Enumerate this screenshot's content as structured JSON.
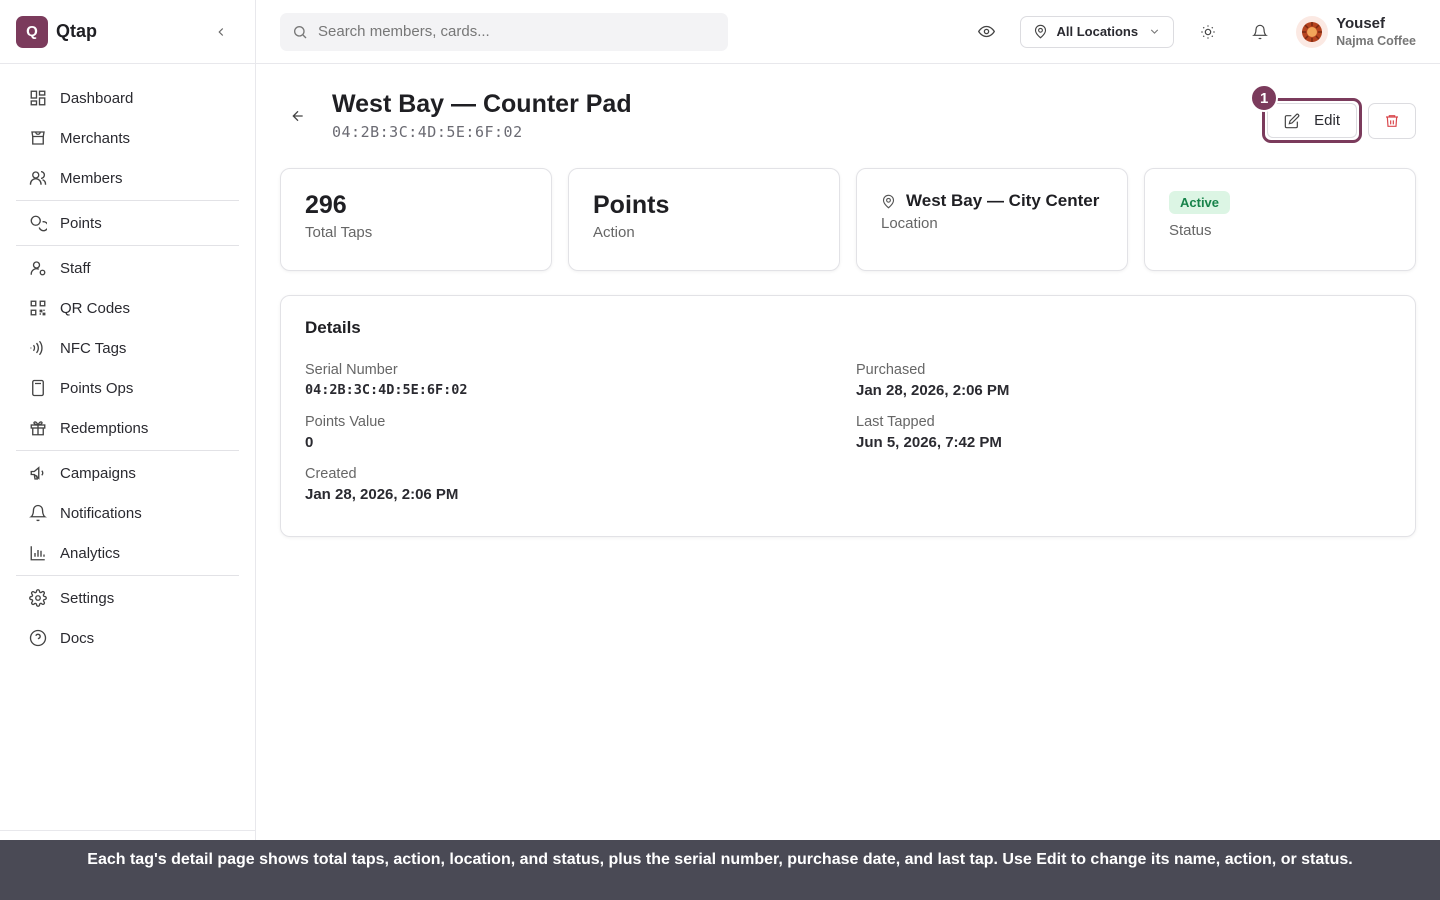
{
  "brand": {
    "logo_letter": "Q",
    "name": "Qtap"
  },
  "sidebar": {
    "items": [
      {
        "label": "Dashboard",
        "icon": "dashboard-icon"
      },
      {
        "label": "Merchants",
        "icon": "store-icon"
      },
      {
        "label": "Members",
        "icon": "users-icon"
      },
      {
        "label": "Points",
        "icon": "coins-icon"
      },
      {
        "label": "Staff",
        "icon": "user-cog-icon"
      },
      {
        "label": "QR Codes",
        "icon": "qr-code-icon"
      },
      {
        "label": "NFC Tags",
        "icon": "nfc-icon"
      },
      {
        "label": "Points Ops",
        "icon": "calculator-icon"
      },
      {
        "label": "Redemptions",
        "icon": "gift-icon"
      },
      {
        "label": "Campaigns",
        "icon": "megaphone-icon"
      },
      {
        "label": "Notifications",
        "icon": "bell-icon"
      },
      {
        "label": "Analytics",
        "icon": "bar-chart-icon"
      },
      {
        "label": "Settings",
        "icon": "gear-icon"
      },
      {
        "label": "Docs",
        "icon": "help-circle-icon"
      }
    ]
  },
  "topbar": {
    "search_placeholder": "Search members, cards...",
    "location_select": "All Locations",
    "user_name": "Yousef",
    "user_org": "Najma Coffee"
  },
  "page": {
    "title": "West Bay — Counter Pad",
    "subtitle": "04:2B:3C:4D:5E:6F:02",
    "edit_label": "Edit",
    "step_badge": "1"
  },
  "stats": {
    "taps_value": "296",
    "taps_label": "Total Taps",
    "action_value": "Points",
    "action_label": "Action",
    "location_value": "West Bay — City Center",
    "location_label": "Location",
    "status_value": "Active",
    "status_label": "Status"
  },
  "details": {
    "title": "Details",
    "serial_label": "Serial Number",
    "serial_value": "04:2B:3C:4D:5E:6F:02",
    "purchased_label": "Purchased",
    "purchased_value": "Jan 28, 2026, 2:06 PM",
    "points_value_label": "Points Value",
    "points_value": "0",
    "last_tapped_label": "Last Tapped",
    "last_tapped_value": "Jun 5, 2026, 7:42 PM",
    "created_label": "Created",
    "created_value": "Jan 28, 2026, 2:06 PM"
  },
  "tip": {
    "text": "Each tag's detail page shows total taps, action, location, and status, plus the serial number, purchase date, and last tap. Use Edit to change its name, action, or status."
  },
  "colors": {
    "brand": "#7b3b5c",
    "danger": "#d9484d",
    "status_bg": "#dcf5e4",
    "status_fg": "#17834a"
  }
}
